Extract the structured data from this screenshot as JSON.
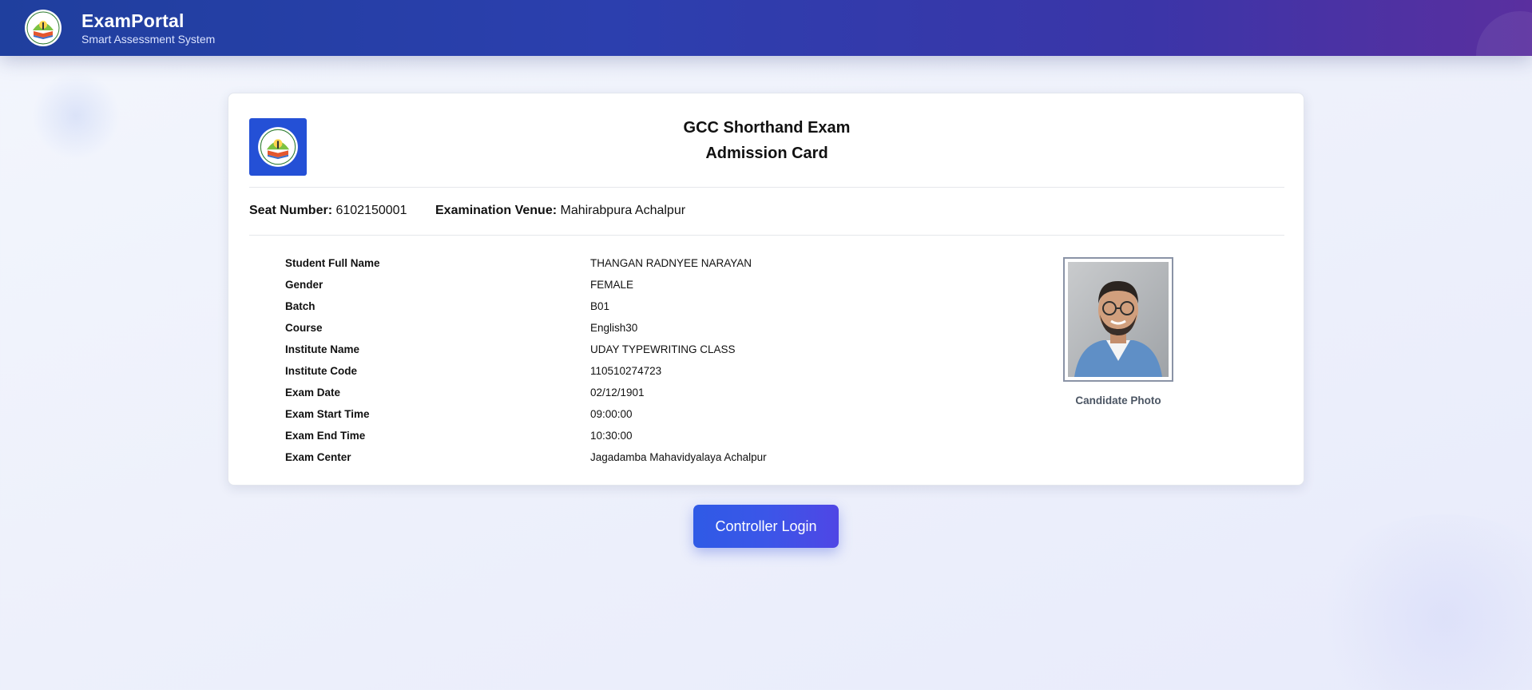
{
  "header": {
    "app_name": "ExamPortal",
    "tagline": "Smart Assessment System",
    "logo_icon": "exam-board-emblem-icon"
  },
  "card": {
    "title_line1": "GCC Shorthand Exam",
    "title_line2": "Admission Card",
    "seat_number_label": "Seat Number:",
    "seat_number_value": "6102150001",
    "venue_label": "Examination Venue:",
    "venue_value": "Mahirabpura Achalpur",
    "details": [
      {
        "label": "Student Full Name",
        "value": "THANGAN RADNYEE NARAYAN"
      },
      {
        "label": "Gender",
        "value": "FEMALE"
      },
      {
        "label": "Batch",
        "value": "B01"
      },
      {
        "label": "Course",
        "value": "English30"
      },
      {
        "label": "Institute Name",
        "value": "UDAY TYPEWRITING CLASS"
      },
      {
        "label": "Institute Code",
        "value": "110510274723"
      },
      {
        "label": "Exam Date",
        "value": "02/12/1901"
      },
      {
        "label": "Exam Start Time",
        "value": "09:00:00"
      },
      {
        "label": "Exam End Time",
        "value": "10:30:00"
      },
      {
        "label": "Exam Center",
        "value": "Jagadamba Mahavidyalaya Achalpur"
      }
    ],
    "photo_caption": "Candidate Photo"
  },
  "actions": {
    "controller_login": "Controller Login"
  },
  "colors": {
    "header_gradient_start": "#1f3f9e",
    "header_gradient_end": "#5a2f9f",
    "logo_tile": "#2450d6",
    "button": "#3b56e8"
  }
}
